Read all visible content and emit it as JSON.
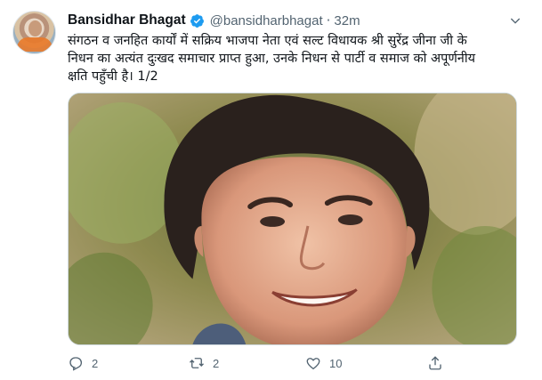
{
  "tweet": {
    "author_name": "Bansidhar Bhagat",
    "handle": "@bansidharbhagat",
    "separator": "·",
    "time": "32m",
    "text_lines": [
      "संगठन व जनहित कार्यों में सक्रिय भाजपा नेता एवं सल्ट विधायक श्री सुरेंद्र जीना जी के",
      "निधन का अत्यंत दुःखद समाचार प्राप्त हुआ, उनके निधन से पार्टी व समाज को अपूर्णनीय",
      "क्षति पहुँची है। 1/2"
    ],
    "icons": {
      "verified": "verified-badge-icon",
      "more": "chevron-down-icon",
      "reply": "reply-icon",
      "retweet": "retweet-icon",
      "like": "heart-icon",
      "share": "share-icon"
    },
    "actions": {
      "reply_count": "2",
      "retweet_count": "2",
      "like_count": "10"
    },
    "colors": {
      "verified_blue": "#1d9bf0",
      "muted": "#536471"
    }
  }
}
